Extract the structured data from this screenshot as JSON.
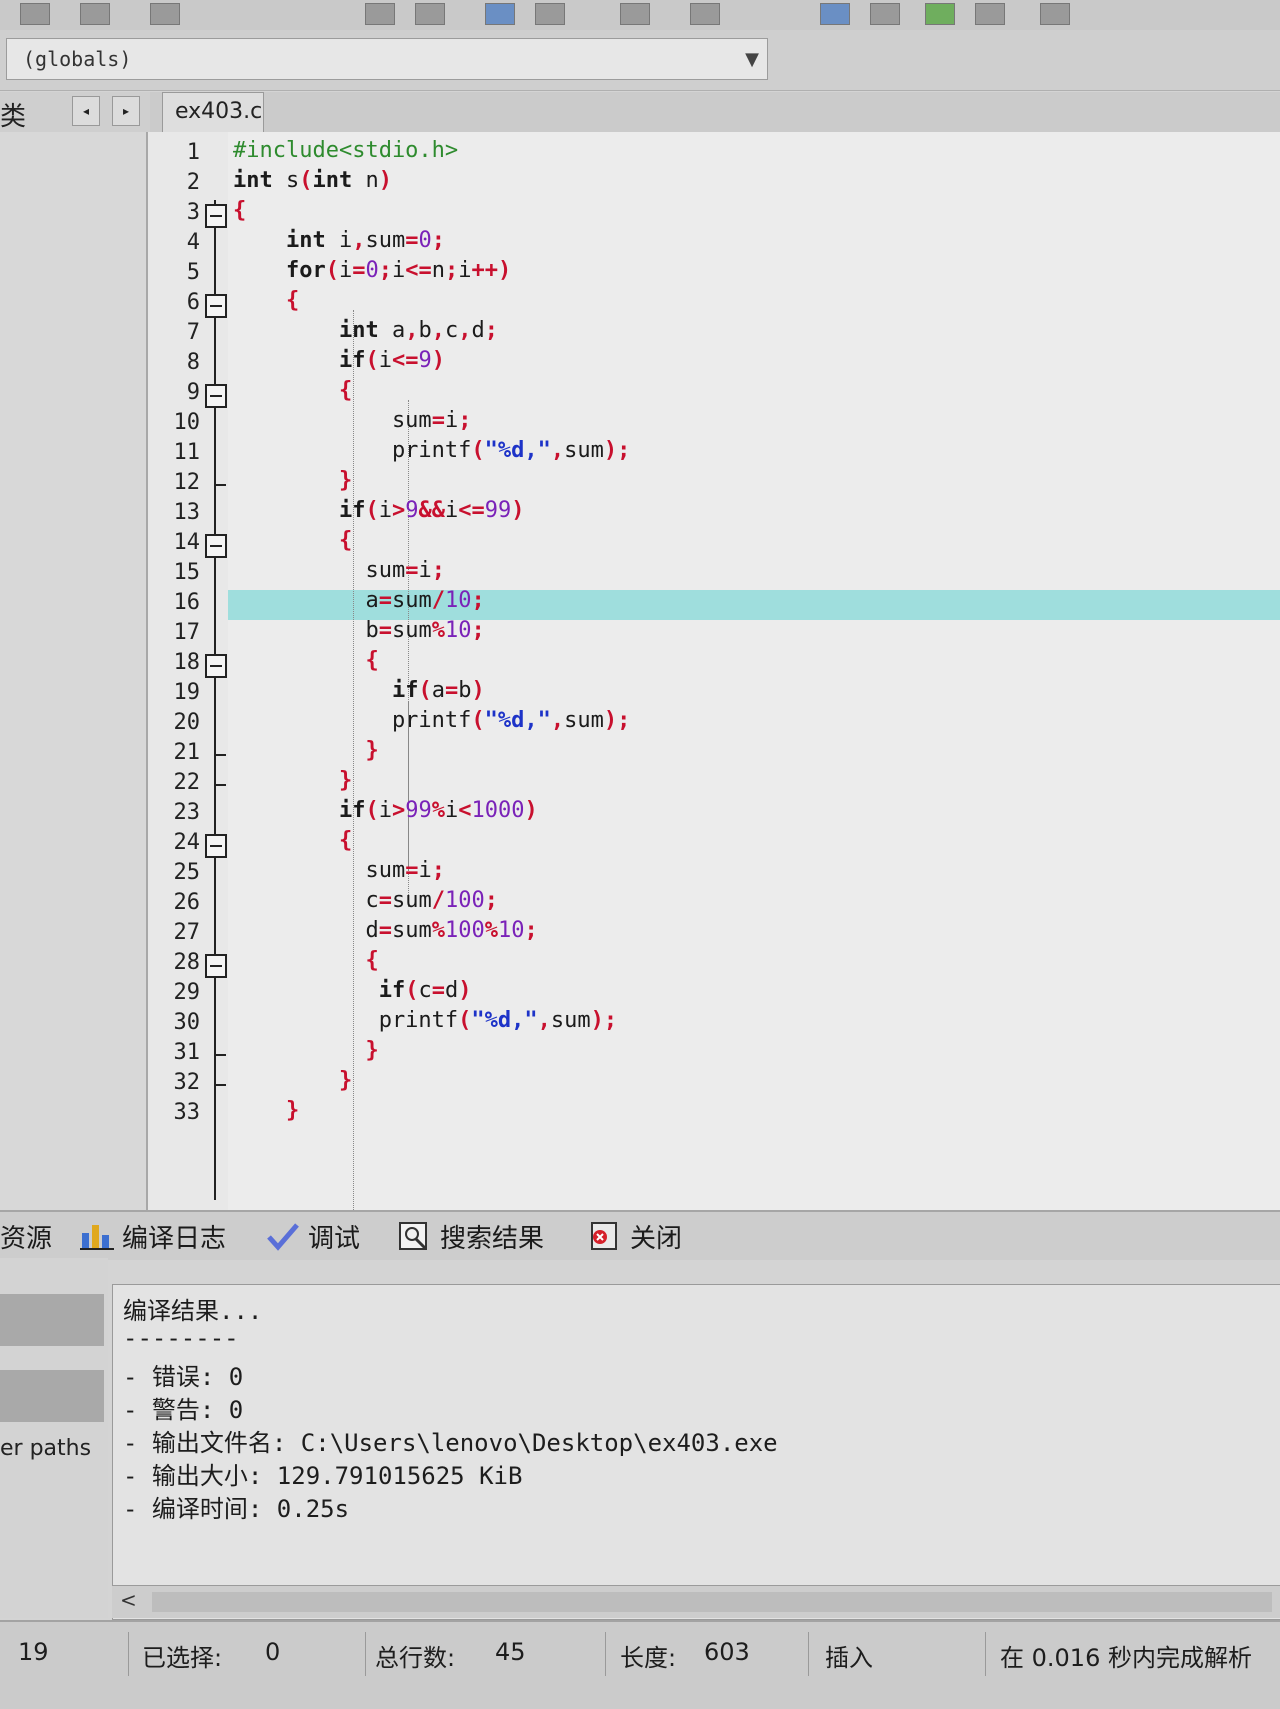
{
  "toolbar": {
    "icons": [
      "save-icon",
      "print-icon",
      "find-icon",
      "replace-icon",
      "window-icon",
      "layout-icon",
      "check-icon"
    ]
  },
  "scope_selector": {
    "value": "(globals)"
  },
  "class_browser": {
    "label": "类",
    "prev": "◂",
    "next": "▸"
  },
  "editor": {
    "active_tab": "ex403.c",
    "cursor_line": 16,
    "line_numbers": [
      "1",
      "2",
      "3",
      "4",
      "5",
      "6",
      "7",
      "8",
      "9",
      "10",
      "11",
      "12",
      "13",
      "14",
      "15",
      "16",
      "17",
      "18",
      "19",
      "20",
      "21",
      "22",
      "23",
      "24",
      "25",
      "26",
      "27",
      "28",
      "29",
      "30",
      "31",
      "32",
      "33"
    ],
    "lines": [
      [
        [
          "pp",
          "#include<stdio.h>"
        ]
      ],
      [
        [
          "kw",
          "int "
        ],
        [
          "id",
          "s"
        ],
        [
          "op",
          "("
        ],
        [
          "kw",
          "int "
        ],
        [
          "id",
          "n"
        ],
        [
          "op",
          ")"
        ]
      ],
      [
        [
          "op",
          "{"
        ]
      ],
      [
        [
          "id",
          "    "
        ],
        [
          "kw",
          "int "
        ],
        [
          "id",
          "i"
        ],
        [
          "op",
          ","
        ],
        [
          "id",
          "sum"
        ],
        [
          "op",
          "="
        ],
        [
          "num",
          "0"
        ],
        [
          "op",
          ";"
        ]
      ],
      [
        [
          "id",
          "    "
        ],
        [
          "kw",
          "for"
        ],
        [
          "op",
          "("
        ],
        [
          "id",
          "i"
        ],
        [
          "op",
          "="
        ],
        [
          "num",
          "0"
        ],
        [
          "op",
          ";"
        ],
        [
          "id",
          "i"
        ],
        [
          "op",
          "<="
        ],
        [
          "id",
          "n"
        ],
        [
          "op",
          ";"
        ],
        [
          "id",
          "i"
        ],
        [
          "op",
          "++)"
        ]
      ],
      [
        [
          "id",
          "    "
        ],
        [
          "op",
          "{"
        ]
      ],
      [
        [
          "id",
          "        "
        ],
        [
          "kw",
          "int "
        ],
        [
          "id",
          "a"
        ],
        [
          "op",
          ","
        ],
        [
          "id",
          "b"
        ],
        [
          "op",
          ","
        ],
        [
          "id",
          "c"
        ],
        [
          "op",
          ","
        ],
        [
          "id",
          "d"
        ],
        [
          "op",
          ";"
        ]
      ],
      [
        [
          "id",
          "        "
        ],
        [
          "kw",
          "if"
        ],
        [
          "op",
          "("
        ],
        [
          "id",
          "i"
        ],
        [
          "op",
          "<="
        ],
        [
          "num",
          "9"
        ],
        [
          "op",
          ")"
        ]
      ],
      [
        [
          "id",
          "        "
        ],
        [
          "op",
          "{"
        ]
      ],
      [
        [
          "id",
          "            sum"
        ],
        [
          "op",
          "="
        ],
        [
          "id",
          "i"
        ],
        [
          "op",
          ";"
        ]
      ],
      [
        [
          "id",
          "            printf"
        ],
        [
          "op",
          "("
        ],
        [
          "str",
          "\"%d,\""
        ],
        [
          "op",
          ","
        ],
        [
          "id",
          "sum"
        ],
        [
          "op",
          ");"
        ]
      ],
      [
        [
          "id",
          "        "
        ],
        [
          "op",
          "}"
        ]
      ],
      [
        [
          "id",
          "        "
        ],
        [
          "kw",
          "if"
        ],
        [
          "op",
          "("
        ],
        [
          "id",
          "i"
        ],
        [
          "op",
          ">"
        ],
        [
          "num",
          "9"
        ],
        [
          "op",
          "&&"
        ],
        [
          "id",
          "i"
        ],
        [
          "op",
          "<="
        ],
        [
          "num",
          "99"
        ],
        [
          "op",
          ")"
        ]
      ],
      [
        [
          "id",
          "        "
        ],
        [
          "op",
          "{"
        ]
      ],
      [
        [
          "id",
          "          sum"
        ],
        [
          "op",
          "="
        ],
        [
          "id",
          "i"
        ],
        [
          "op",
          ";"
        ]
      ],
      [
        [
          "id",
          "          a"
        ],
        [
          "op",
          "="
        ],
        [
          "id",
          "sum"
        ],
        [
          "op",
          "/"
        ],
        [
          "num",
          "10"
        ],
        [
          "op",
          ";"
        ]
      ],
      [
        [
          "id",
          "          b"
        ],
        [
          "op",
          "="
        ],
        [
          "id",
          "sum"
        ],
        [
          "op",
          "%"
        ],
        [
          "num",
          "10"
        ],
        [
          "op",
          ";"
        ]
      ],
      [
        [
          "id",
          "          "
        ],
        [
          "op",
          "{"
        ]
      ],
      [
        [
          "id",
          "            "
        ],
        [
          "kw",
          "if"
        ],
        [
          "op",
          "("
        ],
        [
          "id",
          "a"
        ],
        [
          "op",
          "="
        ],
        [
          "id",
          "b"
        ],
        [
          "op",
          ")"
        ]
      ],
      [
        [
          "id",
          "            printf"
        ],
        [
          "op",
          "("
        ],
        [
          "str",
          "\"%d,\""
        ],
        [
          "op",
          ","
        ],
        [
          "id",
          "sum"
        ],
        [
          "op",
          ");"
        ]
      ],
      [
        [
          "id",
          "          "
        ],
        [
          "op",
          "}"
        ]
      ],
      [
        [
          "id",
          "        "
        ],
        [
          "op",
          "}"
        ]
      ],
      [
        [
          "id",
          "        "
        ],
        [
          "kw",
          "if"
        ],
        [
          "op",
          "("
        ],
        [
          "id",
          "i"
        ],
        [
          "op",
          ">"
        ],
        [
          "num",
          "99"
        ],
        [
          "op",
          "%"
        ],
        [
          "id",
          "i"
        ],
        [
          "op",
          "<"
        ],
        [
          "num",
          "1000"
        ],
        [
          "op",
          ")"
        ]
      ],
      [
        [
          "id",
          "        "
        ],
        [
          "op",
          "{"
        ]
      ],
      [
        [
          "id",
          "          sum"
        ],
        [
          "op",
          "="
        ],
        [
          "id",
          "i"
        ],
        [
          "op",
          ";"
        ]
      ],
      [
        [
          "id",
          "          c"
        ],
        [
          "op",
          "="
        ],
        [
          "id",
          "sum"
        ],
        [
          "op",
          "/"
        ],
        [
          "num",
          "100"
        ],
        [
          "op",
          ";"
        ]
      ],
      [
        [
          "id",
          "          d"
        ],
        [
          "op",
          "="
        ],
        [
          "id",
          "sum"
        ],
        [
          "op",
          "%"
        ],
        [
          "num",
          "100"
        ],
        [
          "op",
          "%"
        ],
        [
          "num",
          "10"
        ],
        [
          "op",
          ";"
        ]
      ],
      [
        [
          "id",
          "          "
        ],
        [
          "op",
          "{"
        ]
      ],
      [
        [
          "id",
          "           "
        ],
        [
          "kw",
          "if"
        ],
        [
          "op",
          "("
        ],
        [
          "id",
          "c"
        ],
        [
          "op",
          "="
        ],
        [
          "id",
          "d"
        ],
        [
          "op",
          ")"
        ]
      ],
      [
        [
          "id",
          "           printf"
        ],
        [
          "op",
          "("
        ],
        [
          "str",
          "\"%d,\""
        ],
        [
          "op",
          ","
        ],
        [
          "id",
          "sum"
        ],
        [
          "op",
          ");"
        ]
      ],
      [
        [
          "id",
          "          "
        ],
        [
          "op",
          "}"
        ]
      ],
      [
        [
          "id",
          "        "
        ],
        [
          "op",
          "}"
        ]
      ],
      [
        [
          "id",
          "    "
        ],
        [
          "op",
          "}"
        ]
      ]
    ]
  },
  "bottom_tabs": [
    {
      "label": "资源",
      "icon": "resources-icon"
    },
    {
      "label": "编译日志",
      "icon": "chart-icon"
    },
    {
      "label": "调试",
      "icon": "check-icon"
    },
    {
      "label": "搜索结果",
      "icon": "search-icon"
    },
    {
      "label": "关闭",
      "icon": "close-icon"
    }
  ],
  "left_panel": {
    "paths_label": "er paths"
  },
  "compile_log": {
    "lines": [
      "编译结果...",
      "--------",
      "- 错误: 0",
      "- 警告: 0",
      "- 输出文件名: C:\\Users\\lenovo\\Desktop\\ex403.exe",
      "- 输出大小: 129.791015625 KiB",
      "- 编译时间: 0.25s"
    ],
    "scroll_left": "<"
  },
  "status_bar": {
    "line": "19",
    "selected_label": "已选择:",
    "selected_value": "0",
    "total_lines_label": "总行数:",
    "total_lines_value": "45",
    "length_label": "长度:",
    "length_value": "603",
    "mode": "插入",
    "parse_info": "在 0.016 秒内完成解析"
  }
}
